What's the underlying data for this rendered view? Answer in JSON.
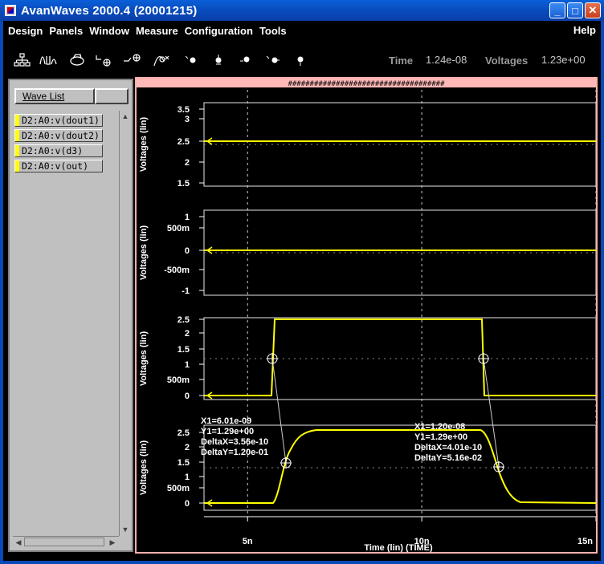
{
  "window": {
    "title": "AvanWaves 2000.4   (20001215)",
    "buttons": {
      "minimize": "_",
      "maximize": "□",
      "close": "✕"
    }
  },
  "menu": {
    "items": [
      {
        "label": "Design"
      },
      {
        "label": "Panels"
      },
      {
        "label": "Window"
      },
      {
        "label": "Measure"
      },
      {
        "label": "Configuration"
      },
      {
        "label": "Tools"
      }
    ],
    "help": "Help"
  },
  "toolbar": {
    "icons": [
      "hierarchy-icon",
      "waveform-icon",
      "printer-icon",
      "zoom-in-icon",
      "zoom-fit-icon",
      "measure-icon",
      "cursor-icon",
      "marker-icon",
      "marker-left-icon",
      "marker-right-icon",
      "marker-down-icon"
    ],
    "time_label": "Time",
    "time_value": "1.24e-08",
    "voltages_label": "Voltages",
    "voltages_value": "1.23e+00"
  },
  "wave_list": {
    "button_label": "Wave List",
    "items": [
      {
        "label": "D2:A0:v(dout1)"
      },
      {
        "label": "D2:A0:v(dout2)"
      },
      {
        "label": "D2:A0:v(d3)"
      },
      {
        "label": "D2:A0:v(out)"
      }
    ]
  },
  "plot": {
    "header": "####################################",
    "trace_color": "#ffff00",
    "panels": [
      {
        "ylabel": "Voltages (lin)",
        "ticks": [
          "3.5",
          "3",
          "2.5",
          "2",
          "1.5"
        ]
      },
      {
        "ylabel": "Voltages (lin)",
        "ticks": [
          "1",
          "500m",
          "0",
          "-500m",
          "-1"
        ]
      },
      {
        "ylabel": "Voltages (lin)",
        "ticks": [
          "2.5",
          "2",
          "1.5",
          "1",
          "500m",
          "0"
        ]
      },
      {
        "ylabel": "Voltages (lin)",
        "ticks": [
          "2.5",
          "2",
          "1.5",
          "1",
          "500m",
          "0"
        ]
      }
    ],
    "x_ticks": [
      "5n",
      "10n",
      "15n"
    ],
    "xlabel": "Time (lin) (TIME)",
    "measure1": [
      "X1=6.01e-09",
      "Y1=1.29e+00",
      "DeltaX=3.56e-10",
      "DeltaY=1.20e-01"
    ],
    "measure2": [
      "X1=1.20e-08",
      "Y1=1.29e+00",
      "DeltaX=4.01e-10",
      "DeltaY=5.16e-02"
    ]
  }
}
